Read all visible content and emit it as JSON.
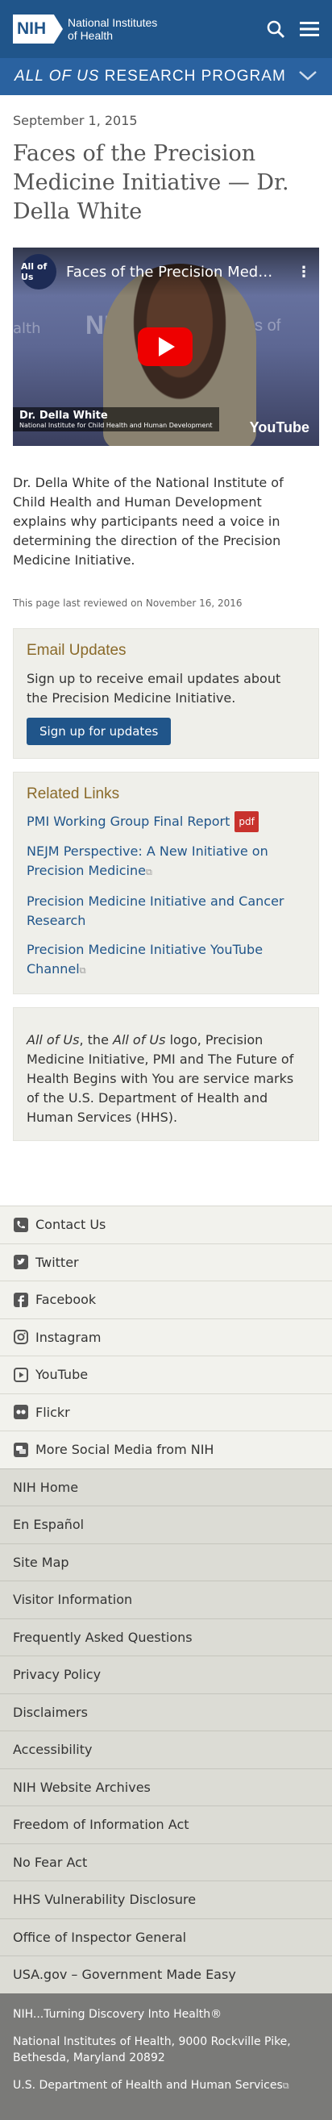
{
  "header": {
    "logo_mark": "NIH",
    "logo_line1": "National Institutes",
    "logo_line2": "of Health",
    "search_icon": "search-icon",
    "menu_icon": "hamburger-menu-icon"
  },
  "program_bar": {
    "title_italic": "ALL OF US",
    "title_rest": " RESEARCH PROGRAM",
    "toggle_icon": "chevron-down-icon"
  },
  "article": {
    "date": "September 1, 2015",
    "title": "Faces of the Precision Medicine Initiative — Dr. Della White",
    "video": {
      "channel": "All of Us",
      "title": "Faces of the Precision Medicin...",
      "bg_nih": "NIH",
      "bg_institutes": "Institutes of Health",
      "bg_left": "alth",
      "caption_name": "Dr. Della White",
      "caption_org": "National Institute for Child Health and Human Development",
      "logo": "YouTube"
    },
    "body": "Dr. Della White of the National Institute of Child Health and Human Development explains why participants need a voice in determining the direction of the Precision Medicine Initiative.",
    "reviewed": "This page last reviewed on November 16, 2016"
  },
  "email_updates": {
    "heading": "Email Updates",
    "text": "Sign up to receive email updates about the Precision Medicine Initiative.",
    "button": "Sign up for updates"
  },
  "related": {
    "heading": "Related Links",
    "items": [
      {
        "label": "PMI Working Group Final Report",
        "badge": "pdf"
      },
      {
        "label": "NEJM Perspective: A New Initiative on Precision Medicine"
      },
      {
        "label": "Precision Medicine Initiative and Cancer Research"
      },
      {
        "label": "Precision Medicine Initiative YouTube Channel"
      }
    ]
  },
  "trademark": {
    "p1": "All of Us",
    "p2": ", the ",
    "p3": "All of Us",
    "p4": " logo, Precision Medicine Initiative, PMI and The Future of Health Begins with You are service marks of the U.S. Department of Health and Human Services (HHS)."
  },
  "social": [
    {
      "label": "Contact Us",
      "icon": "phone-icon"
    },
    {
      "label": "Twitter",
      "icon": "twitter-icon"
    },
    {
      "label": "Facebook",
      "icon": "facebook-icon"
    },
    {
      "label": "Instagram",
      "icon": "instagram-icon"
    },
    {
      "label": "YouTube",
      "icon": "youtube-icon"
    },
    {
      "label": "Flickr",
      "icon": "flickr-icon"
    },
    {
      "label": "More Social Media from NIH",
      "icon": "chat-icon"
    }
  ],
  "footer_nav": [
    "NIH Home",
    "En Español",
    "Site Map",
    "Visitor Information",
    "Frequently Asked Questions",
    "Privacy Policy",
    "Disclaimers",
    "Accessibility",
    "NIH Website Archives",
    "Freedom of Information Act",
    "No Fear Act",
    "HHS Vulnerability Disclosure",
    "Office of Inspector General",
    "USA.gov – Government Made Easy"
  ],
  "bottom": {
    "tagline": "NIH...Turning Discovery Into Health®",
    "address": "National Institutes of Health, 9000 Rockville Pike, Bethesda, Maryland 20892",
    "hhs": "U.S. Department of Health and Human Services"
  }
}
